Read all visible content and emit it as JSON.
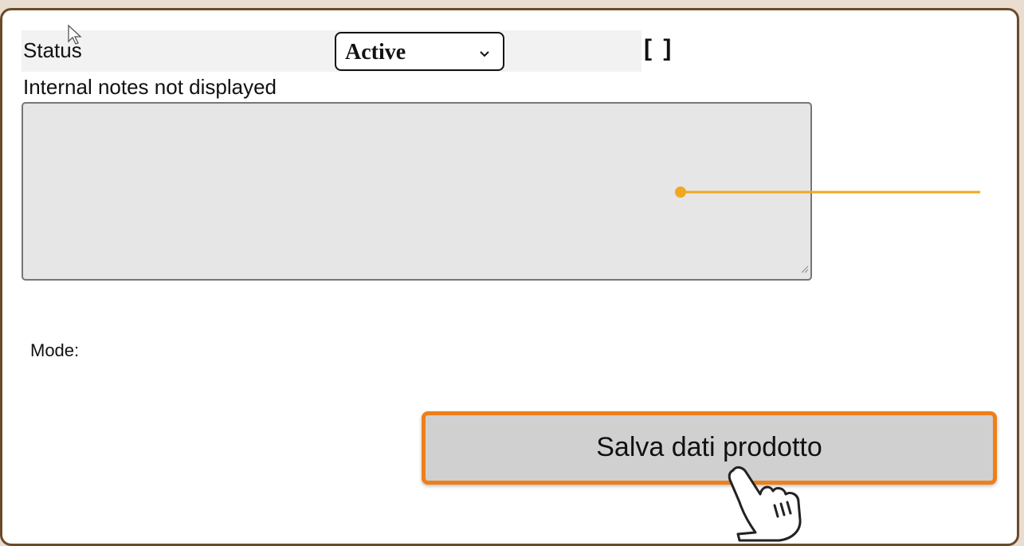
{
  "form": {
    "status_label": "Status",
    "status_value": "Active",
    "brackets_text": "[ ]",
    "notes_label": "Internal notes not displayed",
    "notes_value": "",
    "mode_label": "Mode:",
    "save_button_label": "Salva dati prodotto"
  },
  "colors": {
    "accent_orange": "#f07f19",
    "annotation_line": "#f0a820",
    "frame_border": "#6b4a2a"
  },
  "icons": {
    "select_chevron": "chevron-down-icon",
    "cursor": "arrow-cursor-icon",
    "pointer": "hand-pointer-icon"
  }
}
